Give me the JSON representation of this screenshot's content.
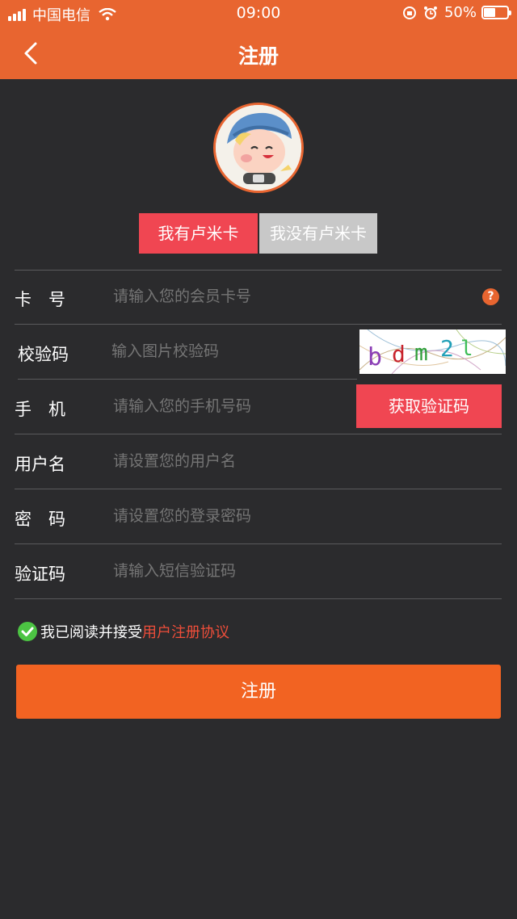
{
  "status_bar": {
    "carrier": "中国电信",
    "time": "09:00",
    "battery_percent": "50%",
    "battery_level": 0.5,
    "icons": [
      "signal-icon",
      "wifi-icon",
      "rotation-lock-icon",
      "alarm-icon",
      "battery-icon"
    ]
  },
  "nav": {
    "title": "注册",
    "back_icon": "chevron-left-icon"
  },
  "tabs": {
    "have_card": "我有卢米卡",
    "no_card": "我没有卢米卡"
  },
  "form": {
    "card_no": {
      "label": "卡　号",
      "placeholder": "请输入您的会员卡号",
      "help_icon": "question-icon"
    },
    "captcha": {
      "label": "校验码",
      "placeholder": "输入图片校验码",
      "image_text": "bdm2l"
    },
    "phone": {
      "label": "手　机",
      "placeholder": "请输入您的手机号码",
      "button": "获取验证码"
    },
    "username": {
      "label": "用户名",
      "placeholder": "请设置您的用户名"
    },
    "password": {
      "label": "密　码",
      "placeholder": "请设置您的登录密码"
    },
    "sms_code": {
      "label": "验证码",
      "placeholder": "请输入短信验证码"
    }
  },
  "agreement": {
    "text": "我已阅读并接受",
    "link": "用户注册协议",
    "checked": true
  },
  "submit_label": "注册",
  "colors": {
    "accent": "#e86530",
    "primary_button": "#f26322",
    "red": "#f04652",
    "background": "#2b2b2d",
    "check": "#4cc443"
  }
}
